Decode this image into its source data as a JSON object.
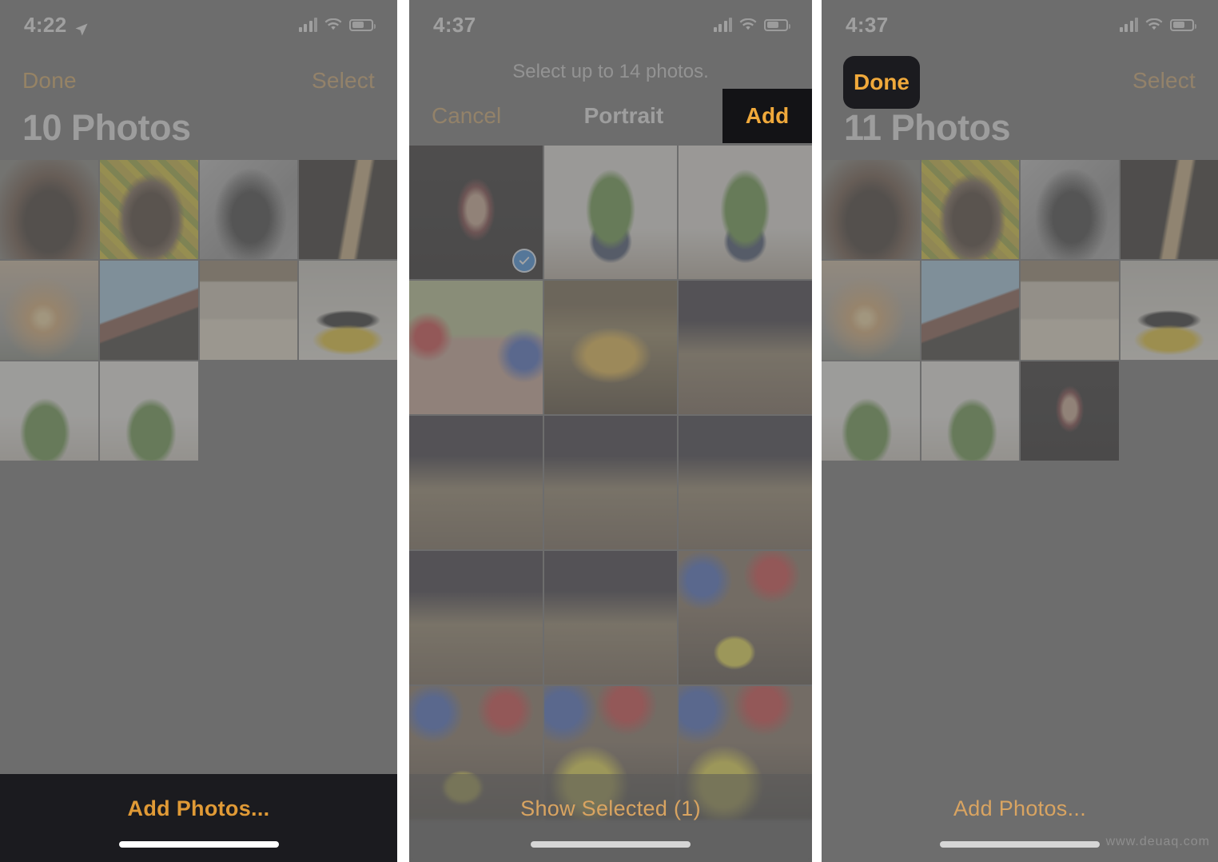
{
  "watermark": "www.deuaq.com",
  "panel1": {
    "status": {
      "time": "4:22",
      "location_icon": "location-arrow-icon",
      "signal_icon": "cellular-signal-icon",
      "wifi_icon": "wifi-icon",
      "battery_icon": "battery-icon"
    },
    "nav": {
      "done": "Done",
      "select": "Select"
    },
    "title": "10 Photos",
    "bottom": {
      "add_photos": "Add Photos...",
      "home_indicator": "home-indicator"
    },
    "photos": [
      {
        "name": "man-with-sunglasses",
        "alt": "Man wearing dark sunglasses outdoors"
      },
      {
        "name": "man-yellow-wall",
        "alt": "Man in front of yellow flower wall"
      },
      {
        "name": "man-bw-portrait",
        "alt": "Black and white portrait of man"
      },
      {
        "name": "hand-on-rope",
        "alt": "Hand gripping rope on dark background"
      },
      {
        "name": "sunset-haze",
        "alt": "Hazy sunset over trees"
      },
      {
        "name": "house-sky",
        "alt": "Rooftop against blue sky"
      },
      {
        "name": "flower-bouquet",
        "alt": "Yellow flower bouquet in doorway"
      },
      {
        "name": "number-one-cake",
        "alt": "Yellow number one birthday cake"
      },
      {
        "name": "hulk-figure-1",
        "alt": "Green Hulk action figure"
      },
      {
        "name": "hulk-figure-2",
        "alt": "Green Hulk action figure second shot"
      }
    ]
  },
  "panel2": {
    "status": {
      "time": "4:37",
      "signal_icon": "cellular-signal-icon",
      "wifi_icon": "wifi-icon",
      "battery_icon": "battery-icon"
    },
    "hint": "Select up to 14 photos.",
    "nav": {
      "cancel": "Cancel",
      "title": "Portrait",
      "add": "Add"
    },
    "bottom": {
      "show_selected": "Show Selected (1)",
      "home_indicator": "home-indicator"
    },
    "selected_count": 1,
    "photos": [
      {
        "name": "woman-dark-portrait",
        "alt": "Woman in dark portrait mode",
        "selected": true
      },
      {
        "name": "hulk-figure-a",
        "alt": "Hulk action figure standing",
        "selected": false
      },
      {
        "name": "hulk-figure-b",
        "alt": "Hulk action figure standing duplicate",
        "selected": false
      },
      {
        "name": "couple-party",
        "alt": "Couple at decorated party",
        "selected": false
      },
      {
        "name": "birthday-cake-lit",
        "alt": "Lit birthday cake close-up",
        "selected": false
      },
      {
        "name": "boy-party-hat-1",
        "alt": "Boy in party hat with cake",
        "selected": false
      },
      {
        "name": "boy-party-hat-2",
        "alt": "Boy in party hat with cake",
        "selected": false
      },
      {
        "name": "boy-party-hat-3",
        "alt": "Boy in party hat with cake",
        "selected": false
      },
      {
        "name": "boy-party-hat-4",
        "alt": "Boy in party hat with cake",
        "selected": false
      },
      {
        "name": "boy-party-hat-5",
        "alt": "Boy in party hat with cake",
        "selected": false
      },
      {
        "name": "boy-party-cake-6",
        "alt": "Boy blowing candles",
        "selected": false
      },
      {
        "name": "boy-party-cake-7",
        "alt": "Boy at cake table",
        "selected": false
      },
      {
        "name": "boy-party-cake-8",
        "alt": "Boy at cake table",
        "selected": false
      },
      {
        "name": "family-balloon-1",
        "alt": "Family with emoji balloon",
        "selected": false
      },
      {
        "name": "family-balloon-2",
        "alt": "Family with emoji balloon duplicate",
        "selected": false
      }
    ]
  },
  "panel3": {
    "status": {
      "time": "4:37",
      "signal_icon": "cellular-signal-icon",
      "wifi_icon": "wifi-icon",
      "battery_icon": "battery-icon"
    },
    "nav": {
      "done": "Done",
      "select": "Select"
    },
    "title": "11 Photos",
    "bottom": {
      "add_photos": "Add Photos...",
      "home_indicator": "home-indicator"
    },
    "photos": [
      {
        "name": "man-with-sunglasses",
        "alt": "Man wearing dark sunglasses outdoors"
      },
      {
        "name": "man-yellow-wall",
        "alt": "Man in front of yellow flower wall"
      },
      {
        "name": "man-bw-portrait",
        "alt": "Black and white portrait of man"
      },
      {
        "name": "hand-on-rope",
        "alt": "Hand gripping rope on dark background"
      },
      {
        "name": "sunset-haze",
        "alt": "Hazy sunset over trees"
      },
      {
        "name": "house-sky",
        "alt": "Rooftop against blue sky"
      },
      {
        "name": "flower-bouquet",
        "alt": "Yellow flower bouquet in doorway"
      },
      {
        "name": "number-one-cake",
        "alt": "Yellow number one birthday cake"
      },
      {
        "name": "hulk-figure-1",
        "alt": "Green Hulk action figure"
      },
      {
        "name": "hulk-figure-2",
        "alt": "Green Hulk action figure second shot"
      },
      {
        "name": "woman-dark-portrait",
        "alt": "Newly added woman portrait"
      }
    ]
  },
  "colors": {
    "accent": "#d8a657",
    "highlight_accent": "#f0a93b",
    "highlight_bg": "#1b1b1f",
    "selected_blue": "#2f86e0",
    "screen_dim": "#6d6d6d"
  }
}
